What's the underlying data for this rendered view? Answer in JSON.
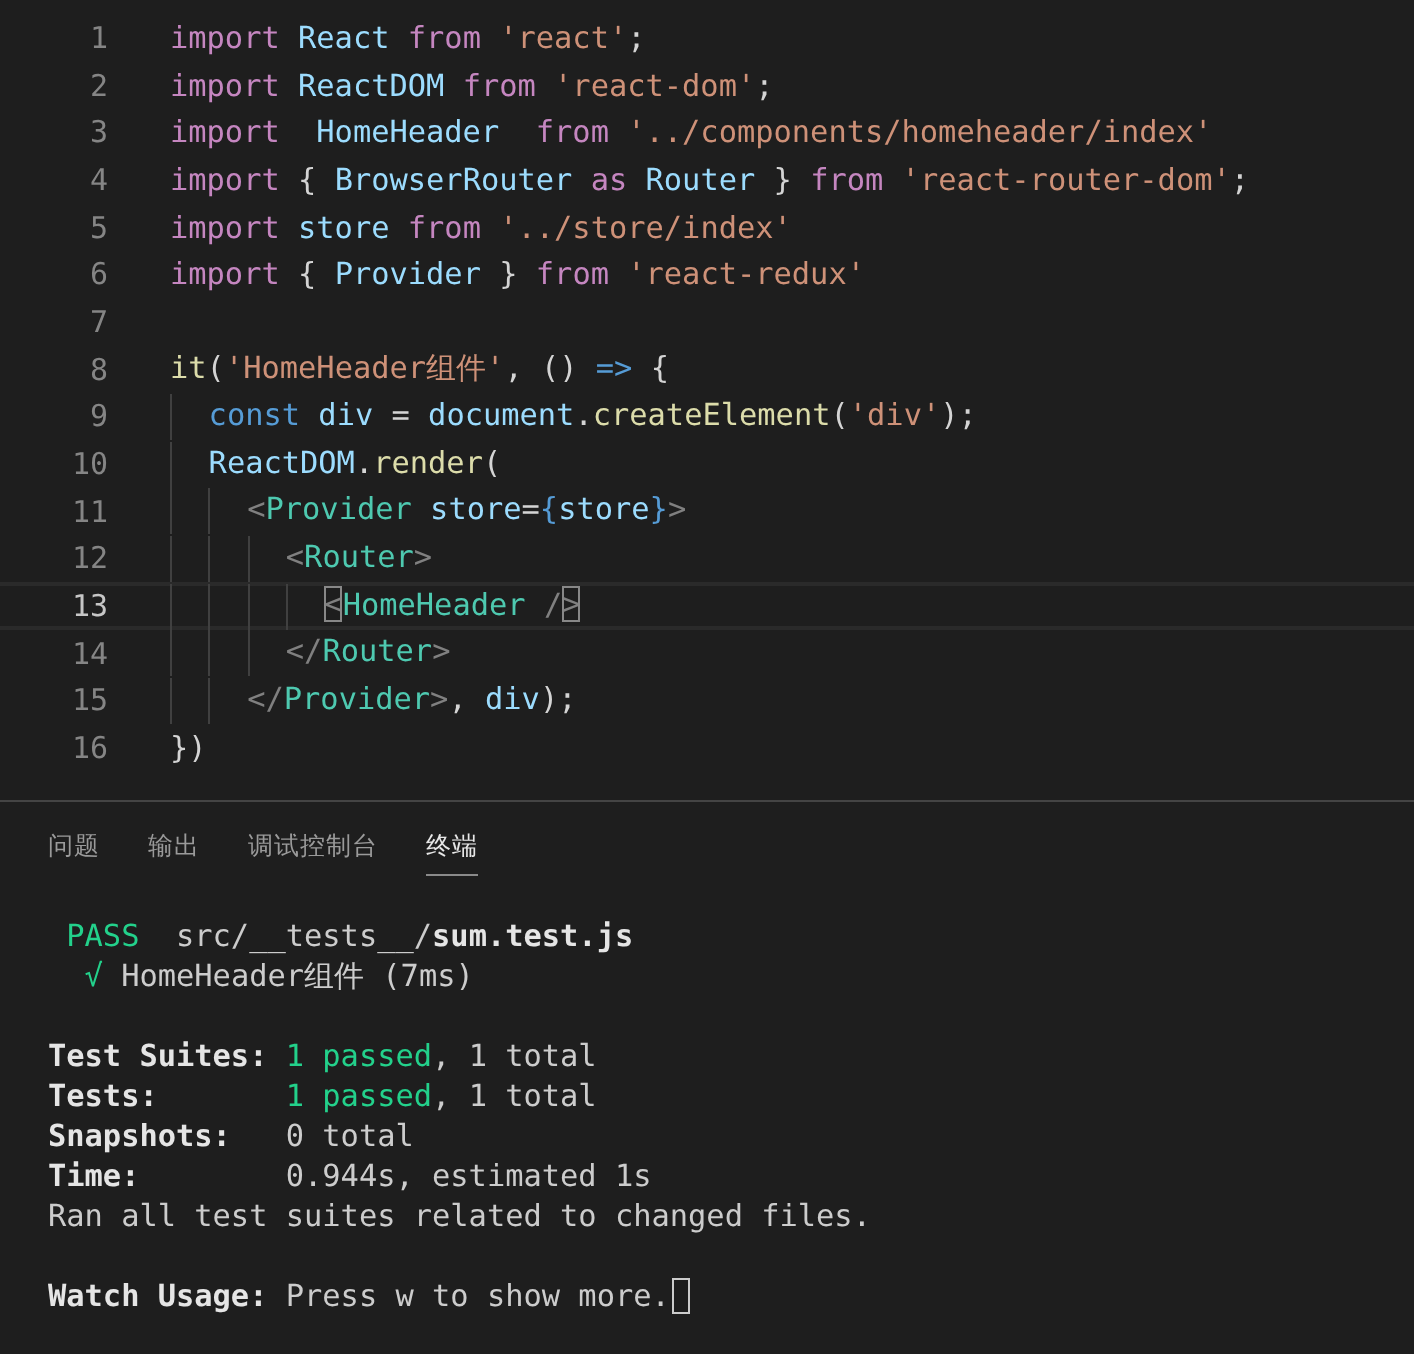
{
  "editor": {
    "lines": [
      {
        "number": "1",
        "selected": false,
        "tokens": [
          {
            "kind": "keyword",
            "text": "import "
          },
          {
            "kind": "variable",
            "text": "React "
          },
          {
            "kind": "keyword",
            "text": "from "
          },
          {
            "kind": "string",
            "text": "'react'"
          },
          {
            "kind": "plain",
            "text": ";"
          }
        ]
      },
      {
        "number": "2",
        "selected": false,
        "tokens": [
          {
            "kind": "keyword",
            "text": "import "
          },
          {
            "kind": "variable",
            "text": "ReactDOM "
          },
          {
            "kind": "keyword",
            "text": "from "
          },
          {
            "kind": "string",
            "text": "'react-dom'"
          },
          {
            "kind": "plain",
            "text": ";"
          }
        ]
      },
      {
        "number": "3",
        "selected": false,
        "tokens": [
          {
            "kind": "keyword",
            "text": "import  "
          },
          {
            "kind": "variable",
            "text": "HomeHeader  "
          },
          {
            "kind": "keyword",
            "text": "from "
          },
          {
            "kind": "string",
            "text": "'../components/homeheader/index'"
          }
        ]
      },
      {
        "number": "4",
        "selected": false,
        "tokens": [
          {
            "kind": "keyword",
            "text": "import "
          },
          {
            "kind": "plain",
            "text": "{ "
          },
          {
            "kind": "variable",
            "text": "BrowserRouter "
          },
          {
            "kind": "keyword",
            "text": "as "
          },
          {
            "kind": "variable",
            "text": "Router "
          },
          {
            "kind": "plain",
            "text": "} "
          },
          {
            "kind": "keyword",
            "text": "from "
          },
          {
            "kind": "string",
            "text": "'react-router-dom'"
          },
          {
            "kind": "plain",
            "text": ";"
          }
        ]
      },
      {
        "number": "5",
        "selected": false,
        "tokens": [
          {
            "kind": "keyword",
            "text": "import "
          },
          {
            "kind": "variable",
            "text": "store "
          },
          {
            "kind": "keyword",
            "text": "from "
          },
          {
            "kind": "string",
            "text": "'../store/index'"
          }
        ]
      },
      {
        "number": "6",
        "selected": false,
        "tokens": [
          {
            "kind": "keyword",
            "text": "import "
          },
          {
            "kind": "plain",
            "text": "{ "
          },
          {
            "kind": "variable",
            "text": "Provider "
          },
          {
            "kind": "plain",
            "text": "} "
          },
          {
            "kind": "keyword",
            "text": "from "
          },
          {
            "kind": "string",
            "text": "'react-redux'"
          }
        ]
      },
      {
        "number": "7",
        "selected": false
      },
      {
        "number": "8",
        "selected": false,
        "tokens": [
          {
            "kind": "function",
            "text": "it"
          },
          {
            "kind": "plain",
            "text": "("
          },
          {
            "kind": "string",
            "text": "'HomeHeader组件'"
          },
          {
            "kind": "plain",
            "text": ", () "
          },
          {
            "kind": "storage",
            "text": "=> "
          },
          {
            "kind": "plain",
            "text": "{"
          }
        ]
      },
      {
        "number": "9",
        "selected": false,
        "tokens": [
          {
            "kind": "storage",
            "text": "  const "
          },
          {
            "kind": "variable",
            "text": "div "
          },
          {
            "kind": "plain",
            "text": "= "
          },
          {
            "kind": "variable",
            "text": "document"
          },
          {
            "kind": "plain",
            "text": "."
          },
          {
            "kind": "function",
            "text": "createElement"
          },
          {
            "kind": "plain",
            "text": "("
          },
          {
            "kind": "string",
            "text": "'div'"
          },
          {
            "kind": "plain",
            "text": ");"
          }
        ]
      },
      {
        "number": "10",
        "selected": false,
        "tokens": [
          {
            "kind": "variable",
            "text": "  ReactDOM"
          },
          {
            "kind": "plain",
            "text": "."
          },
          {
            "kind": "function",
            "text": "render"
          },
          {
            "kind": "plain",
            "text": "("
          }
        ]
      },
      {
        "number": "11",
        "selected": false,
        "tokens": [
          {
            "kind": "bracket",
            "text": "    <"
          },
          {
            "kind": "tag",
            "text": "Provider "
          },
          {
            "kind": "variable",
            "text": "store"
          },
          {
            "kind": "plain",
            "text": "="
          },
          {
            "kind": "storage",
            "text": "{"
          },
          {
            "kind": "variable",
            "text": "store"
          },
          {
            "kind": "storage",
            "text": "}"
          },
          {
            "kind": "bracket",
            "text": ">"
          }
        ]
      },
      {
        "number": "12",
        "selected": false,
        "tokens": [
          {
            "kind": "bracket",
            "text": "      <"
          },
          {
            "kind": "tag",
            "text": "Router"
          },
          {
            "kind": "bracket",
            "text": ">"
          }
        ]
      },
      {
        "number": "13",
        "selected": true,
        "tokens": [
          {
            "kind": "match",
            "text": "        <"
          },
          {
            "kind": "tag",
            "text": "HomeHeader "
          },
          {
            "kind": "bracket",
            "text": "/"
          },
          {
            "kind": "match",
            "text": ">"
          }
        ]
      },
      {
        "number": "14",
        "selected": false,
        "tokens": [
          {
            "kind": "bracket",
            "text": "      </"
          },
          {
            "kind": "tag",
            "text": "Router"
          },
          {
            "kind": "bracket",
            "text": ">"
          }
        ]
      },
      {
        "number": "15",
        "selected": false,
        "tokens": [
          {
            "kind": "bracket",
            "text": "    </"
          },
          {
            "kind": "tag",
            "text": "Provider"
          },
          {
            "kind": "bracket",
            "text": ">"
          },
          {
            "kind": "plain",
            "text": ", "
          },
          {
            "kind": "variable",
            "text": "div"
          },
          {
            "kind": "plain",
            "text": ");"
          }
        ]
      },
      {
        "number": "16",
        "selected": false,
        "tokens": [
          {
            "kind": "plain",
            "text": "})"
          }
        ]
      }
    ]
  },
  "panel": {
    "tabs": [
      {
        "label": "问题",
        "selected": false
      },
      {
        "label": "输出",
        "selected": false
      },
      {
        "label": "调试控制台",
        "selected": false
      },
      {
        "label": "终端",
        "selected": true
      }
    ],
    "terminal": {
      "cursor": true,
      "blocks": [
        [
          {
            "segments": [
              {
                "kind": "green",
                "text": " PASS"
              },
              {
                "kind": "plain",
                "text": "  src/__tests__/"
              },
              {
                "kind": "bold",
                "text": "sum.test.js"
              }
            ]
          },
          {
            "segments": [
              {
                "kind": "green",
                "text": "  √"
              },
              {
                "kind": "plain",
                "text": " HomeHeader组件 (7ms)"
              }
            ]
          }
        ],
        [
          {
            "segments": [
              {
                "kind": "bold",
                "text": "Test Suites:"
              },
              {
                "kind": "green",
                "text": " 1 passed"
              },
              {
                "kind": "plain",
                "text": ", 1 total"
              }
            ]
          },
          {
            "segments": [
              {
                "kind": "bold",
                "text": "Tests:"
              },
              {
                "kind": "green",
                "text": "       1 passed"
              },
              {
                "kind": "plain",
                "text": ", 1 total"
              }
            ]
          },
          {
            "segments": [
              {
                "kind": "bold",
                "text": "Snapshots:"
              },
              {
                "kind": "plain",
                "text": "   0 total"
              }
            ]
          },
          {
            "segments": [
              {
                "kind": "bold",
                "text": "Time:"
              },
              {
                "kind": "plain",
                "text": "        0.944s, estimated 1s"
              }
            ]
          },
          {
            "segments": [
              {
                "kind": "plain",
                "text": "Ran all test suites related to changed files."
              }
            ]
          }
        ],
        [
          {
            "segments": [
              {
                "kind": "bold",
                "text": "Watch Usage:"
              },
              {
                "kind": "plain",
                "text": " Press w to show more."
              }
            ]
          }
        ]
      ]
    }
  }
}
